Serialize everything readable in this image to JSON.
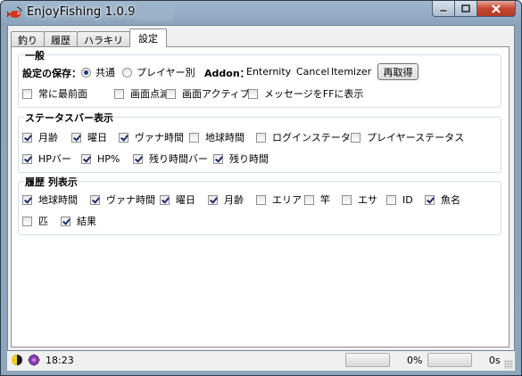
{
  "window": {
    "title": "EnjoyFishing 1.0.9",
    "minimize_label": "minimize",
    "maximize_label": "maximize",
    "close_label": "close"
  },
  "tabs": [
    {
      "label": "釣り",
      "active": false
    },
    {
      "label": "履歴",
      "active": false
    },
    {
      "label": "ハラキリ",
      "active": false
    },
    {
      "label": "設定",
      "active": true
    }
  ],
  "general": {
    "title": "一般",
    "save_label": "設定の保存：",
    "save_options": [
      {
        "label": "共通",
        "selected": true
      },
      {
        "label": "プレイヤー別",
        "selected": false
      }
    ],
    "addon_label": "Addon：",
    "addons": [
      "Enternity",
      "Cancel",
      "Itemizer"
    ],
    "refetch_button": "再取得",
    "options": [
      {
        "label": "常に最前面",
        "checked": false
      },
      {
        "label": "画面点滅",
        "checked": false
      },
      {
        "label": "画面アクティブ",
        "checked": false
      },
      {
        "label": "メッセージをFFに表示",
        "checked": false
      }
    ]
  },
  "statusbar_display": {
    "title": "ステータスバー表示",
    "row1": [
      {
        "label": "月齢",
        "checked": true
      },
      {
        "label": "曜日",
        "checked": true
      },
      {
        "label": "ヴァナ時間",
        "checked": true
      },
      {
        "label": "地球時間",
        "checked": false
      },
      {
        "label": "ログインステータス",
        "checked": false
      },
      {
        "label": "プレイヤーステータス",
        "checked": false
      }
    ],
    "row2": [
      {
        "label": "HPバー",
        "checked": true
      },
      {
        "label": "HP%",
        "checked": true
      },
      {
        "label": "残り時間バー",
        "checked": true
      },
      {
        "label": "残り時間",
        "checked": true
      }
    ]
  },
  "history_columns": {
    "title": "履歴 列表示",
    "row1": [
      {
        "label": "地球時間",
        "checked": true
      },
      {
        "label": "ヴァナ時間",
        "checked": true
      },
      {
        "label": "曜日",
        "checked": true
      },
      {
        "label": "月齢",
        "checked": true
      },
      {
        "label": "エリア",
        "checked": false
      },
      {
        "label": "竿",
        "checked": false
      },
      {
        "label": "エサ",
        "checked": false
      },
      {
        "label": "ID",
        "checked": false
      },
      {
        "label": "魚名",
        "checked": true
      }
    ],
    "row2": [
      {
        "label": "匹",
        "checked": false
      },
      {
        "label": "結果",
        "checked": true
      }
    ]
  },
  "status": {
    "time": "18:23",
    "hp_percent": "0%",
    "remaining": "0s",
    "hp_fill": 0,
    "remaining_fill": 0
  },
  "colors": {
    "titlebar": "#8aa3bb",
    "close_button": "#c7452f",
    "check": "#1d2b67",
    "moon_yellow": "#f4cf19"
  }
}
